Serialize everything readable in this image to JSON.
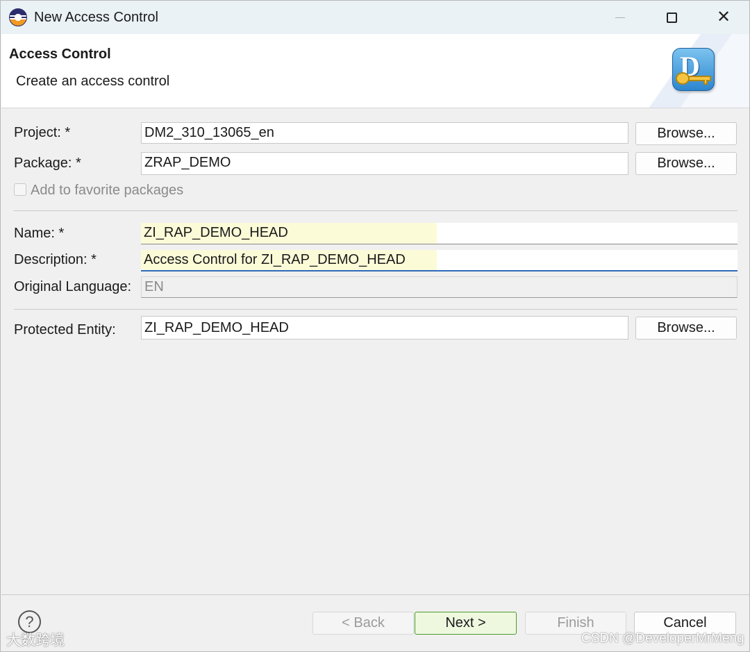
{
  "window": {
    "title": "New Access Control",
    "app_icon": "eclipse-icon",
    "controls": [
      "minimize-icon",
      "maximize-icon",
      "close-icon"
    ]
  },
  "header": {
    "title": "Access Control",
    "subtitle": "Create an access control",
    "icon": "access-control-key-icon",
    "icon_letter": "D"
  },
  "form": {
    "project": {
      "label": "Project: *",
      "value": "DM2_310_13065_en",
      "button": "Browse..."
    },
    "package": {
      "label": "Package: *",
      "value": "ZRAP_DEMO",
      "button": "Browse..."
    },
    "favorite": {
      "label": "Add to favorite packages",
      "checked": false,
      "enabled": false
    },
    "name": {
      "label": "Name: *",
      "value": "ZI_RAP_DEMO_HEAD"
    },
    "description": {
      "label": "Description: *",
      "value": "Access Control for ZI_RAP_DEMO_HEAD"
    },
    "original_language": {
      "label": "Original Language:",
      "value": "EN"
    },
    "protected_entity": {
      "label": "Protected Entity:",
      "value": "ZI_RAP_DEMO_HEAD",
      "button": "Browse..."
    }
  },
  "footer": {
    "help_icon": "help-icon",
    "help_glyph": "?",
    "back": "< Back",
    "next": "Next >",
    "finish": "Finish",
    "cancel": "Cancel"
  },
  "watermarks": {
    "left": "大数跨境",
    "right": "CSDN @DeveloperMrMeng"
  },
  "colors": {
    "titlebar": "#eaf2f5",
    "highlight": "#fbfbd8",
    "focus_underline": "#2d6ab8",
    "primary_border": "#4c9a2a"
  }
}
